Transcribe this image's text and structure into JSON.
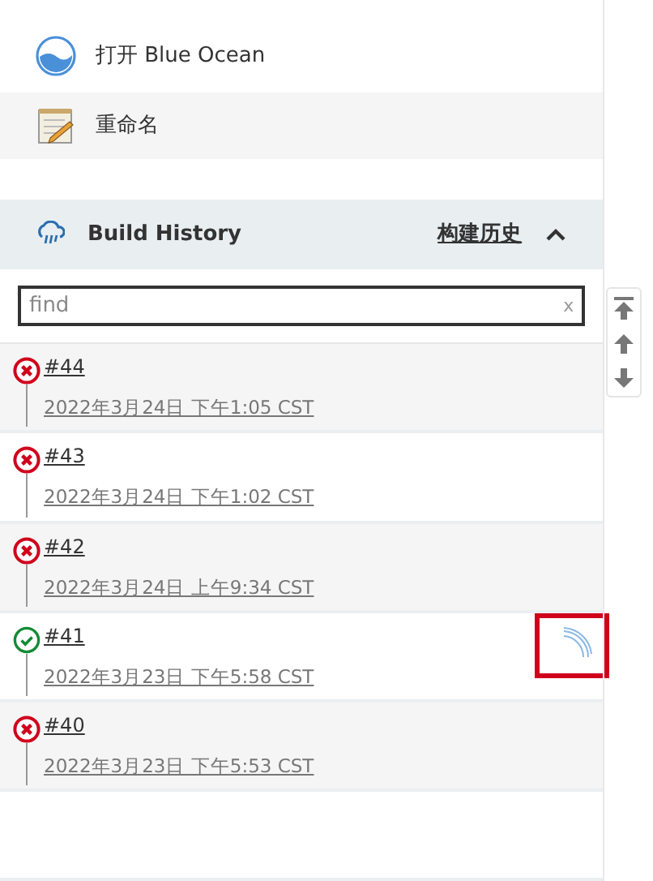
{
  "tasks": [
    {
      "kind": "ocean",
      "label": "打开 Blue Ocean"
    },
    {
      "kind": "rename",
      "label": "重命名"
    }
  ],
  "build_history": {
    "title": "Build History",
    "link": "构建历史",
    "expanded": true,
    "search": {
      "placeholder": "find",
      "clear": "x"
    },
    "builds": [
      {
        "number": "#44",
        "kind": "failed",
        "time": "2022年3月24日 下午1:05 CST",
        "highlighted": false,
        "console": false
      },
      {
        "number": "#43",
        "kind": "failed",
        "time": "2022年3月24日 下午1:02 CST",
        "highlighted": false,
        "console": false
      },
      {
        "number": "#42",
        "kind": "failed",
        "time": "2022年3月24日 上午9:34 CST",
        "highlighted": false,
        "console": false
      },
      {
        "number": "#41",
        "kind": "success",
        "time": "2022年3月23日 下午5:58 CST",
        "highlighted": true,
        "console": true
      },
      {
        "number": "#40",
        "kind": "failed",
        "time": "2022年3月23日 下午5:53 CST",
        "highlighted": false,
        "console": false
      }
    ]
  }
}
